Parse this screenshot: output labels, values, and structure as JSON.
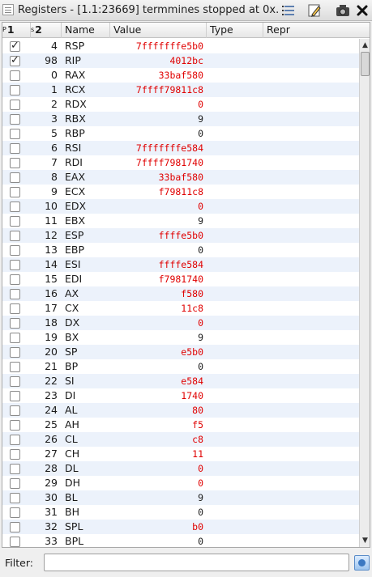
{
  "window": {
    "title": "Registers - [1.1:23669] termmines stopped at 0x..."
  },
  "toolbar": {
    "icons": [
      "column-list-icon",
      "edit-pencil-icon",
      "snapshot-camera-icon",
      "close-icon"
    ]
  },
  "columns": {
    "pin": "P",
    "pin_num": "1",
    "index_label": "s",
    "index_num": "2",
    "name": "Name",
    "value": "Value",
    "type": "Type",
    "repr": "Repr"
  },
  "colors": {
    "changed_value": "#e00000",
    "normal_value": "#1a1a1a",
    "row_alt": "#ecf2fb"
  },
  "registers": [
    {
      "checked": true,
      "index": "4",
      "name": "RSP",
      "value": "7fffffffe5b0",
      "changed": true
    },
    {
      "checked": true,
      "index": "98",
      "name": "RIP",
      "value": "4012bc",
      "changed": true
    },
    {
      "checked": false,
      "index": "0",
      "name": "RAX",
      "value": "33baf580",
      "changed": true
    },
    {
      "checked": false,
      "index": "1",
      "name": "RCX",
      "value": "7ffff79811c8",
      "changed": true
    },
    {
      "checked": false,
      "index": "2",
      "name": "RDX",
      "value": "0",
      "changed": true
    },
    {
      "checked": false,
      "index": "3",
      "name": "RBX",
      "value": "9",
      "changed": false
    },
    {
      "checked": false,
      "index": "5",
      "name": "RBP",
      "value": "0",
      "changed": false
    },
    {
      "checked": false,
      "index": "6",
      "name": "RSI",
      "value": "7fffffffe584",
      "changed": true
    },
    {
      "checked": false,
      "index": "7",
      "name": "RDI",
      "value": "7ffff7981740",
      "changed": true
    },
    {
      "checked": false,
      "index": "8",
      "name": "EAX",
      "value": "33baf580",
      "changed": true
    },
    {
      "checked": false,
      "index": "9",
      "name": "ECX",
      "value": "f79811c8",
      "changed": true
    },
    {
      "checked": false,
      "index": "10",
      "name": "EDX",
      "value": "0",
      "changed": true
    },
    {
      "checked": false,
      "index": "11",
      "name": "EBX",
      "value": "9",
      "changed": false
    },
    {
      "checked": false,
      "index": "12",
      "name": "ESP",
      "value": "ffffe5b0",
      "changed": true
    },
    {
      "checked": false,
      "index": "13",
      "name": "EBP",
      "value": "0",
      "changed": false
    },
    {
      "checked": false,
      "index": "14",
      "name": "ESI",
      "value": "ffffe584",
      "changed": true
    },
    {
      "checked": false,
      "index": "15",
      "name": "EDI",
      "value": "f7981740",
      "changed": true
    },
    {
      "checked": false,
      "index": "16",
      "name": "AX",
      "value": "f580",
      "changed": true
    },
    {
      "checked": false,
      "index": "17",
      "name": "CX",
      "value": "11c8",
      "changed": true
    },
    {
      "checked": false,
      "index": "18",
      "name": "DX",
      "value": "0",
      "changed": true
    },
    {
      "checked": false,
      "index": "19",
      "name": "BX",
      "value": "9",
      "changed": false
    },
    {
      "checked": false,
      "index": "20",
      "name": "SP",
      "value": "e5b0",
      "changed": true
    },
    {
      "checked": false,
      "index": "21",
      "name": "BP",
      "value": "0",
      "changed": false
    },
    {
      "checked": false,
      "index": "22",
      "name": "SI",
      "value": "e584",
      "changed": true
    },
    {
      "checked": false,
      "index": "23",
      "name": "DI",
      "value": "1740",
      "changed": true
    },
    {
      "checked": false,
      "index": "24",
      "name": "AL",
      "value": "80",
      "changed": true
    },
    {
      "checked": false,
      "index": "25",
      "name": "AH",
      "value": "f5",
      "changed": true
    },
    {
      "checked": false,
      "index": "26",
      "name": "CL",
      "value": "c8",
      "changed": true
    },
    {
      "checked": false,
      "index": "27",
      "name": "CH",
      "value": "11",
      "changed": true
    },
    {
      "checked": false,
      "index": "28",
      "name": "DL",
      "value": "0",
      "changed": true
    },
    {
      "checked": false,
      "index": "29",
      "name": "DH",
      "value": "0",
      "changed": true
    },
    {
      "checked": false,
      "index": "30",
      "name": "BL",
      "value": "9",
      "changed": false
    },
    {
      "checked": false,
      "index": "31",
      "name": "BH",
      "value": "0",
      "changed": false
    },
    {
      "checked": false,
      "index": "32",
      "name": "SPL",
      "value": "b0",
      "changed": true
    },
    {
      "checked": false,
      "index": "33",
      "name": "BPL",
      "value": "0",
      "changed": false
    }
  ],
  "filter": {
    "label": "Filter:",
    "value": "",
    "placeholder": ""
  }
}
